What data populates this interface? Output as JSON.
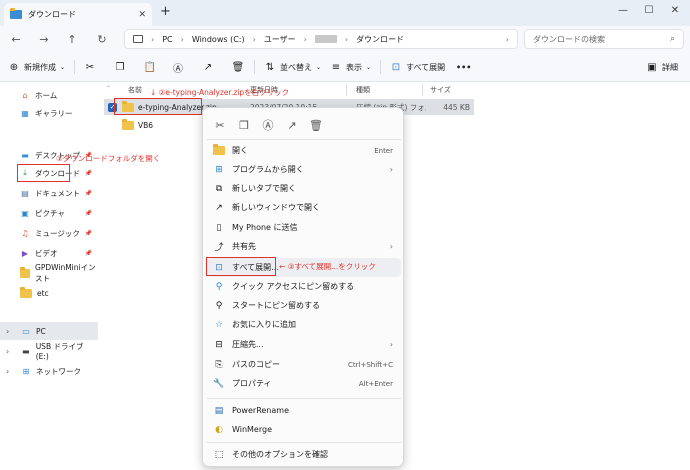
{
  "window": {
    "tab_title": "ダウンロード",
    "new_tab": "+",
    "minimize": "—",
    "maximize": "☐",
    "close": "✕"
  },
  "nav": {
    "breadcrumbs": [
      "PC",
      "Windows (C:)",
      "ユーザー",
      "ダウンロード"
    ],
    "search_placeholder": "ダウンロードの検索"
  },
  "toolbar": {
    "new": "新規作成",
    "sort": "並べ替え",
    "view": "表示",
    "extract_all": "すべて展開",
    "more": "•••",
    "details": "詳細"
  },
  "sidebar": {
    "home": "ホーム",
    "gallery": "ギャラリー",
    "desktop": "デスクトップ",
    "downloads": "ダウンロード",
    "documents": "ドキュメント",
    "pictures": "ピクチャ",
    "music": "ミュージック",
    "videos": "ビデオ",
    "gpd": "GPDWinMiniインスト",
    "etc": "etc",
    "pc": "PC",
    "usb": "USB ドライブ (E:)",
    "network": "ネットワーク"
  },
  "columns": {
    "name": "名前",
    "date": "更新日時",
    "type": "種類",
    "size": "サイズ"
  },
  "files": [
    {
      "name": "e-typing-Analyzer.zip",
      "date": "2023/07/20 10:15",
      "type": "圧縮 (zip 形式) フォルダー",
      "size": "445 KB"
    },
    {
      "name": "VB6",
      "date": "",
      "type": "",
      "size": ""
    }
  ],
  "context_menu": {
    "open": "開く",
    "open_shortcut": "Enter",
    "open_with": "プログラムから開く",
    "new_tab": "新しいタブで開く",
    "new_window": "新しいウィンドウで開く",
    "phone": "My Phone に送信",
    "share": "共有先",
    "extract_all": "すべて展開...",
    "pin_quick": "クイック アクセスにピン留めする",
    "pin_start": "スタートにピン留めする",
    "favorites": "お気に入りに追加",
    "compress": "圧縮先...",
    "copy_path": "パスのコピー",
    "copy_path_shortcut": "Ctrl+Shift+C",
    "properties": "プロパティ",
    "properties_shortcut": "Alt+Enter",
    "power_rename": "PowerRename",
    "winmerge": "WinMerge",
    "more_options": "その他のオプションを確認"
  },
  "annotations": {
    "step1": "①ダウンロードフォルダを開く",
    "step2": "↓ ②e-typing-Analyzer.zipを右クリック",
    "step3": "← ③すべて展開...をクリック"
  }
}
